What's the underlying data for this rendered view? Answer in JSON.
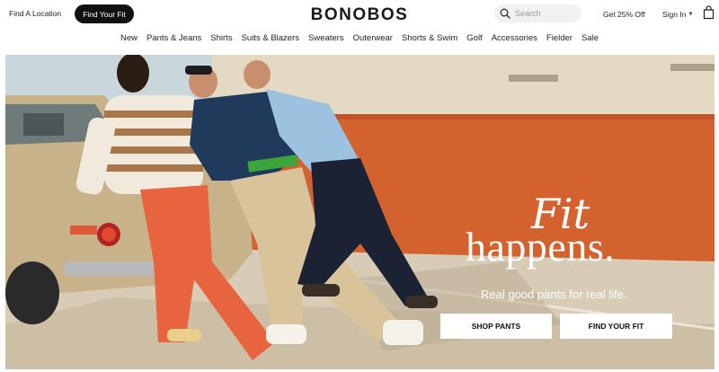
{
  "header": {
    "find_location": "Find A Location",
    "find_your_fit": "Find Your Fit",
    "logo": "BONOBOS",
    "search_placeholder": "Search",
    "promo": "Get 25% Off",
    "sign_in": "Sign In",
    "icons": [
      "search-icon",
      "caret-down-icon",
      "shopping-bag-icon"
    ]
  },
  "nav": {
    "items": [
      "New",
      "Pants & Jeans",
      "Shirts",
      "Suits & Blazers",
      "Sweaters",
      "Outerwear",
      "Shorts & Swim",
      "Golf",
      "Accessories",
      "Fielder",
      "Sale"
    ]
  },
  "hero": {
    "headline_line1": "Fit",
    "headline_line2": "happens.",
    "subhead": "Real good pants for real life.",
    "cta_primary": "SHOP PANTS",
    "cta_secondary": "FIND YOUR FIT"
  },
  "colors": {
    "accent_wall": "#d3622f",
    "button_dark": "#111111",
    "text": "#222222"
  }
}
